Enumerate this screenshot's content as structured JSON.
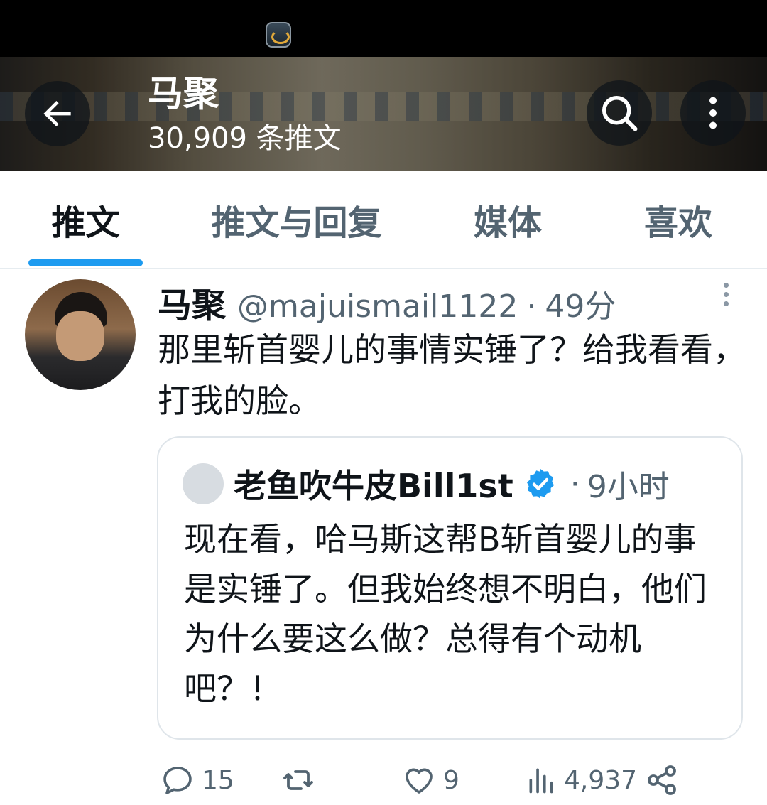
{
  "header": {
    "title": "马聚",
    "subtitle": "30,909 条推文"
  },
  "tabs": [
    {
      "label": "推文",
      "active": true
    },
    {
      "label": "推文与回复",
      "active": false
    },
    {
      "label": "媒体",
      "active": false
    },
    {
      "label": "喜欢",
      "active": false
    }
  ],
  "tweet": {
    "name": "马聚",
    "handle": "@majuismail1122",
    "dot": "·",
    "time": "49分",
    "text": "那里斩首婴儿的事情实锤了？给我看看，打我的脸。",
    "quote": {
      "name": "老鱼吹牛皮Bill1st",
      "dot": "·",
      "time": "9小时",
      "text": "现在看，哈马斯这帮B斩首婴儿的事是实锤了。但我始终想不明白，他们为什么要这么做？总得有个动机吧？！"
    },
    "actions": {
      "replies": "15",
      "likes": "9",
      "views": "4,937"
    }
  },
  "colors": {
    "accent": "#1d9bf0",
    "text_primary": "#0f1419",
    "text_secondary": "#536471",
    "verified": "#1d9bf0"
  },
  "icons": [
    "back-arrow-icon",
    "search-icon",
    "more-vertical-icon",
    "verified-badge-icon",
    "reply-icon",
    "retweet-icon",
    "like-icon",
    "views-icon",
    "share-icon"
  ]
}
